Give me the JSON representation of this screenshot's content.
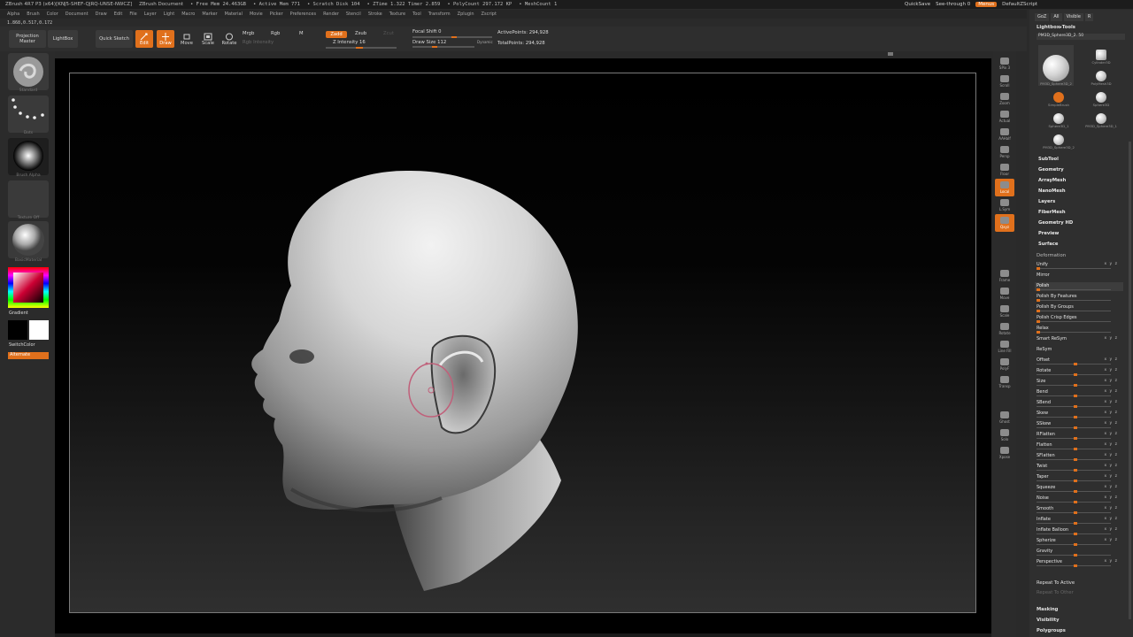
{
  "titlebar": {
    "app": "ZBrush 4R7 P3 (x64)[KNJ5-SHEF-QJRQ-UNSE-NWCZ]",
    "document": "ZBrush Document",
    "free_mem": "• Free Mem 24.463GB",
    "active_mem": "• Active Mem 771",
    "scratch_disk": "• Scratch Disk 104",
    "ztime": "• ZTime 1.322  Timer 2.859",
    "poly_count": "• PolyCount 297.172 KP",
    "mesh_count": "• MeshCount 1",
    "quicksave": "QuickSave",
    "see_through": "See-through  0",
    "menus": "Menus",
    "script": "DefaultZScript"
  },
  "menubar": [
    "Alpha",
    "Brush",
    "Color",
    "Document",
    "Draw",
    "Edit",
    "File",
    "Layer",
    "Light",
    "Macro",
    "Marker",
    "Material",
    "Movie",
    "Picker",
    "Preferences",
    "Render",
    "Stencil",
    "Stroke",
    "Texture",
    "Tool",
    "Transform",
    "Zplugin",
    "Zscript"
  ],
  "coords": "1.868,0.517,0.172",
  "shelf": {
    "projection_master": "Projection Master",
    "lightbox": "LightBox",
    "quick_sketch": "Quick Sketch",
    "edit": "Edit",
    "draw": "Draw",
    "move": "Move",
    "scale": "Scale",
    "rotate": "Rotate",
    "mrgb": "Mrgb",
    "rgb": "Rgb",
    "m": "M",
    "rgb_intensity": "Rgb Intensity",
    "zadd": "Zadd",
    "zsub": "Zsub",
    "zcut": "Zcut",
    "z_intensity": "Z Intensity 16",
    "focal_shift": "Focal Shift 0",
    "draw_size": "Draw Size 112",
    "dynamic": "Dynamic",
    "active_points": "ActivePoints: 294,928",
    "total_points": "TotalPoints: 294,928"
  },
  "left_tray": {
    "brush_label": "Standard",
    "stroke_label": "Dots",
    "alpha_label": "Brush Alpha",
    "texture_label": "Texture Off",
    "material_label": "BasicMaterial",
    "gradient": "Gradient",
    "switch_color": "SwitchColor",
    "alternate": "Alternate"
  },
  "right_shelf": [
    "SPix 3",
    "Scroll",
    "Zoom",
    "Actual",
    "AAHalf",
    "Persp",
    "Floor",
    "Local",
    "L.Sym",
    "Qxyz",
    "",
    "",
    "Frame",
    "Move",
    "Scale",
    "Rotate",
    "Line Fill",
    "PolyF",
    "Transp",
    "",
    "Ghost",
    "Solo",
    "Xpose"
  ],
  "palette": {
    "tabs": [
      "GoZ",
      "All",
      "Visible",
      "R"
    ],
    "lightbox_tools": "Lightbox▸Tools",
    "current_tool": "PM3D_Sphere3D_2. 50",
    "tools": [
      {
        "name": "PM3D_Sphere3D_2"
      },
      {
        "name": "Cylinder3D"
      },
      {
        "name": "PolyMesh3D"
      },
      {
        "name": "SimpleBrush"
      },
      {
        "name": "Sphere3D"
      },
      {
        "name": "Sphere3D_1"
      },
      {
        "name": "PM3D_Sphere3D_1"
      },
      {
        "name": "PM3D_Sphere3D_2"
      }
    ],
    "menu_items": [
      "SubTool",
      "Geometry",
      "ArrayMesh",
      "NanoMesh",
      "Layers",
      "FiberMesh",
      "Geometry HD",
      "Preview",
      "Surface"
    ],
    "deformation_title": "Deformation",
    "deformation_rows": [
      {
        "label": "Unify",
        "value": 0.0,
        "axes": "x y z"
      },
      {
        "label": "Mirror",
        "value": null,
        "axes": ""
      },
      {
        "label": "Polish",
        "value": 0.0,
        "axes": ""
      },
      {
        "label": "Polish By Features",
        "value": 0.0,
        "axes": ""
      },
      {
        "label": "Polish By Groups",
        "value": 0.0,
        "axes": ""
      },
      {
        "label": "Polish Crisp Edges",
        "value": 0.0,
        "axes": ""
      },
      {
        "label": "Relax",
        "value": 0.0,
        "axes": ""
      },
      {
        "label": "Smart ReSym",
        "value": null,
        "axes": "x y z"
      },
      {
        "label": "ReSym",
        "value": null,
        "axes": ""
      },
      {
        "label": "Offset",
        "value": 0.5,
        "axes": "x y z"
      },
      {
        "label": "Rotate",
        "value": 0.5,
        "axes": "x y z"
      },
      {
        "label": "Size",
        "value": 0.5,
        "axes": "x y z"
      },
      {
        "label": "Bend",
        "value": 0.5,
        "axes": "x y z"
      },
      {
        "label": "SBend",
        "value": 0.5,
        "axes": "x y z"
      },
      {
        "label": "Skew",
        "value": 0.5,
        "axes": "x y z"
      },
      {
        "label": "SSkew",
        "value": 0.5,
        "axes": "x y z"
      },
      {
        "label": "RFlatten",
        "value": 0.5,
        "axes": "x y z"
      },
      {
        "label": "Flatten",
        "value": 0.5,
        "axes": "x y z"
      },
      {
        "label": "SFlatten",
        "value": 0.5,
        "axes": "x y z"
      },
      {
        "label": "Twist",
        "value": 0.5,
        "axes": "x y z"
      },
      {
        "label": "Taper",
        "value": 0.5,
        "axes": "x y z"
      },
      {
        "label": "Squeeze",
        "value": 0.5,
        "axes": "x y z"
      },
      {
        "label": "Noise",
        "value": 0.5,
        "axes": "x y z"
      },
      {
        "label": "Smooth",
        "value": 0.5,
        "axes": "x y z"
      },
      {
        "label": "Inflate",
        "value": 0.5,
        "axes": "x y z"
      },
      {
        "label": "Inflate Balloon",
        "value": 0.5,
        "axes": "x y z"
      },
      {
        "label": "Spherize",
        "value": 0.5,
        "axes": "x y z"
      },
      {
        "label": "Gravity",
        "value": 0.5,
        "axes": ""
      },
      {
        "label": "Perspective",
        "value": 0.5,
        "axes": "x y z"
      }
    ],
    "repeat_to_active": "Repeat To Active",
    "repeat_to_other": "Repeat To Other",
    "footer": [
      "Masking",
      "Visibility",
      "Polygroups"
    ]
  },
  "colors": {
    "accent": "#e0701c",
    "panel": "#2f2f2f",
    "canvas": "#000000"
  }
}
